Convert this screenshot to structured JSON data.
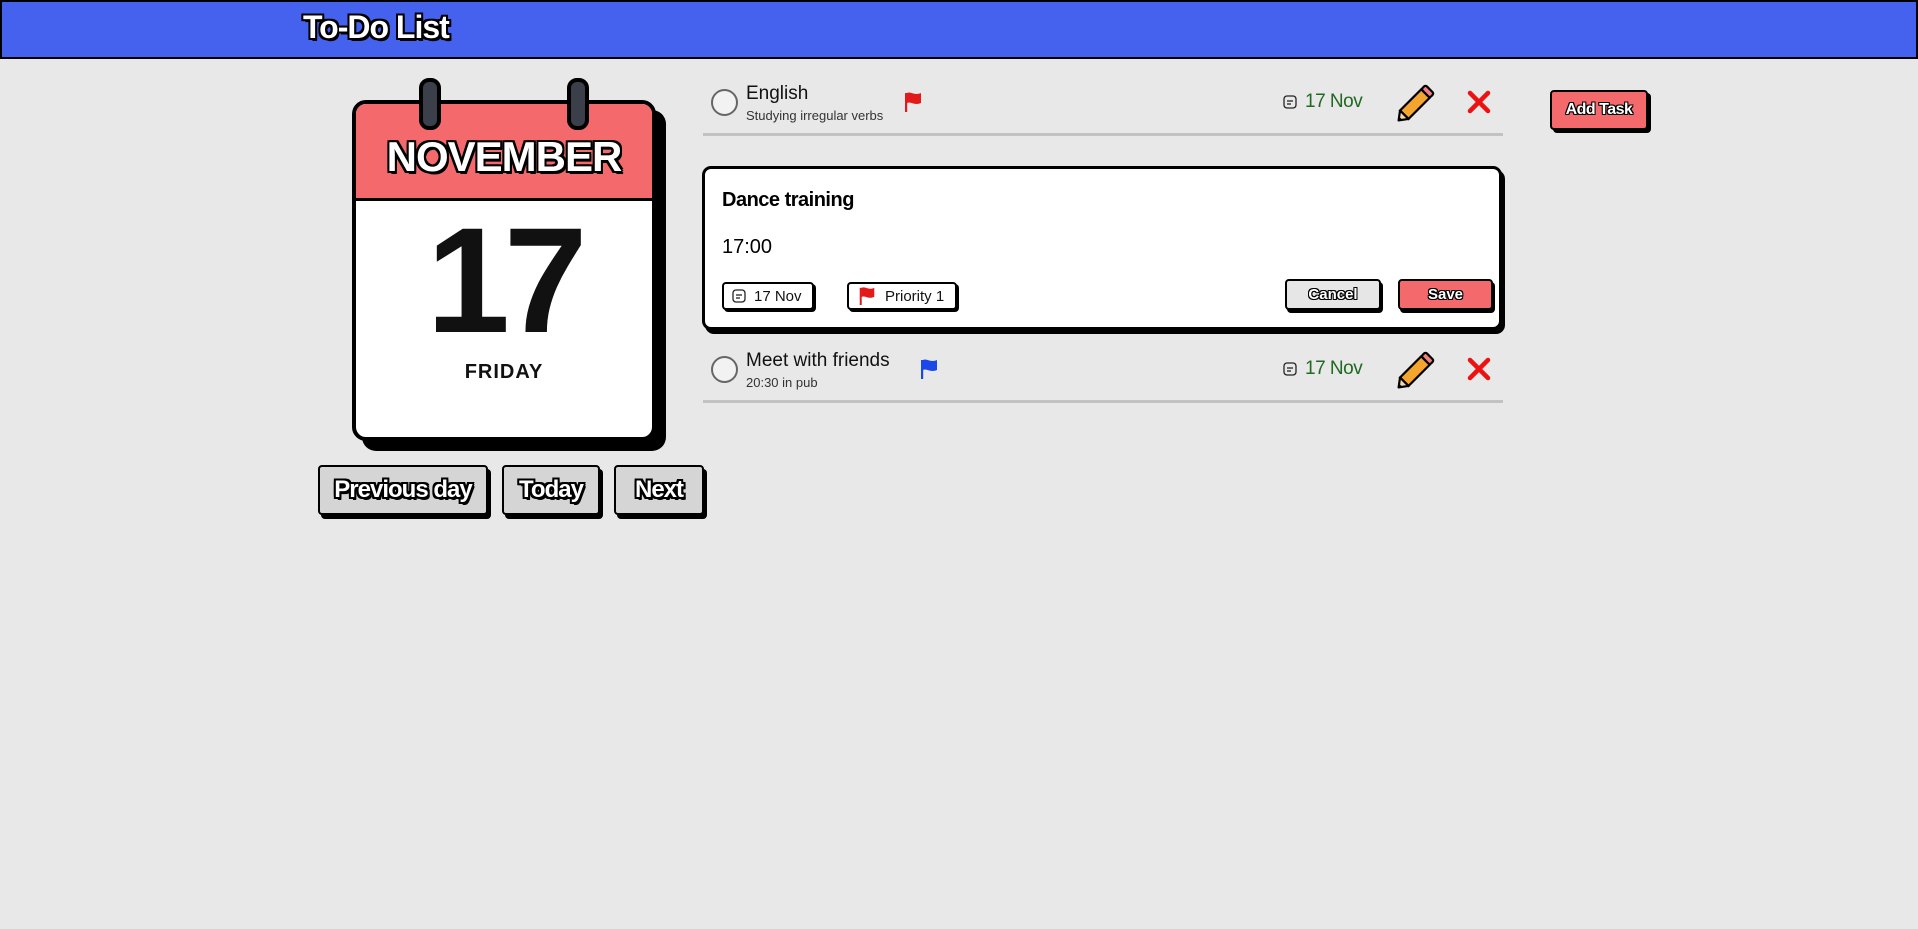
{
  "header": {
    "title": "To-Do List",
    "background": "#4562ee"
  },
  "calendar": {
    "month": "NOVEMBER",
    "day": "17",
    "weekday": "FRIDAY",
    "header_color": "#f4696b"
  },
  "nav": {
    "previous_label": "Previous day",
    "today_label": "Today",
    "next_label": "Next"
  },
  "add_task_label": "Add Task",
  "tasks": [
    {
      "title": "English",
      "description": "Studying irregular verbs",
      "flag_icon": "red-flag-icon",
      "flag_color": "#e21a1a",
      "date": "17 Nov",
      "completed": false
    },
    {
      "title": "Meet with friends",
      "description": "20:30 in pub",
      "flag_icon": "blue-flag-icon",
      "flag_color": "#1a48e8",
      "date": "17 Nov",
      "completed": false
    }
  ],
  "editor": {
    "title_value": "Dance training",
    "description_value": "17:00",
    "date_chip": "17 Nov",
    "priority_chip": "Priority 1",
    "priority_flag_color": "#e21a1a",
    "cancel_label": "Cancel",
    "save_label": "Save"
  },
  "colors": {
    "accent": "#f4696b",
    "date_text": "#1f6a1f",
    "delete": "#ee1111",
    "edit": "#f4a530"
  }
}
